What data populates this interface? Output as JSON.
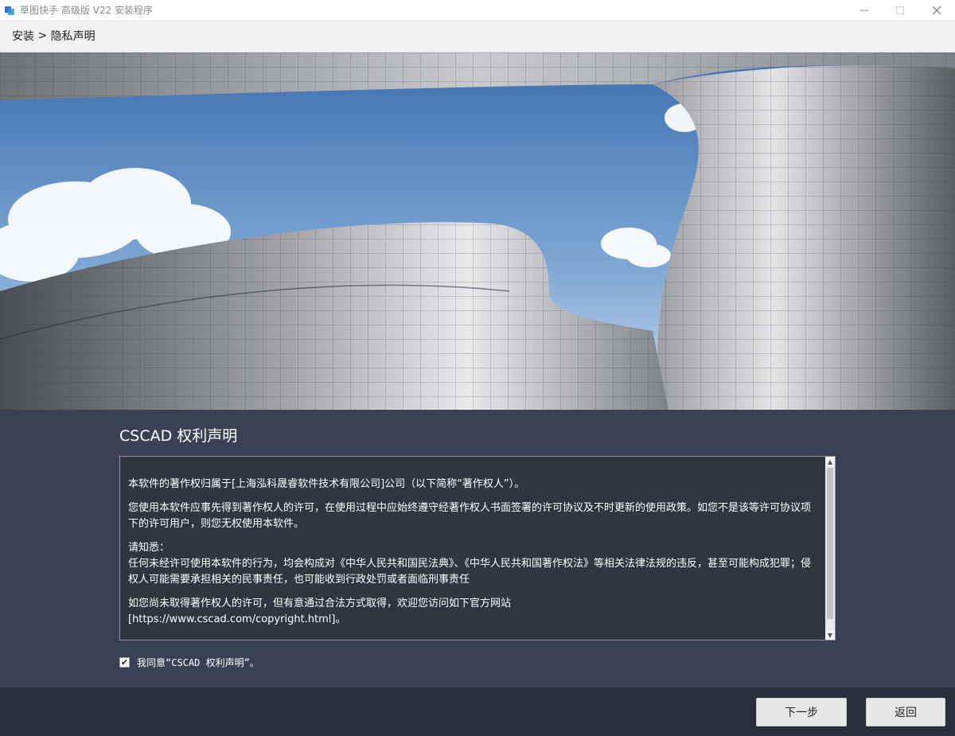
{
  "window": {
    "title": "草图快手 高级版 V22 安装程序",
    "icons": {
      "app": "app-icon",
      "minimize": "minimize-icon",
      "maximize": "maximize-icon",
      "close": "close-icon"
    }
  },
  "breadcrumb": {
    "step1": "安装",
    "separator": " > ",
    "step2": "隐私声明"
  },
  "statement": {
    "heading": "CSCAD 权利声明",
    "paragraphs": [
      "本软件的著作权归属于[上海泓科晟睿软件技术有限公司]公司（以下简称“著作权人”）。",
      "您使用本软件应事先得到著作权人的许可，在使用过程中应始终遵守经著作权人书面签署的许可协议及不时更新的使用政策。如您不是该等许可协议项下的许可用户，则您无权使用本软件。",
      "请知悉：",
      "任何未经许可使用本软件的行为，均会构成对《中华人民共和国民法典》、《中华人民共和国著作权法》等相关法律法规的违反，甚至可能构成犯罪；侵权人可能需要承担相关的民事责任，也可能收到行政处罚或者面临刑事责任",
      "如您尚未取得著作权人的许可，但有意通过合法方式取得，欢迎您访问如下官方网站",
      "[https://www.cscad.com/copyright.html]。"
    ]
  },
  "agreement": {
    "checked": true,
    "check_mark": "✔",
    "label": "我同意“CSCAD 权利声明”。"
  },
  "buttons": {
    "next": "下一步",
    "back": "返回"
  },
  "colors": {
    "content_bg": "#3b4055",
    "textbox_bg": "#31353f",
    "footer_bg": "#2b2f3c",
    "button_bg": "#e7e7e7"
  }
}
